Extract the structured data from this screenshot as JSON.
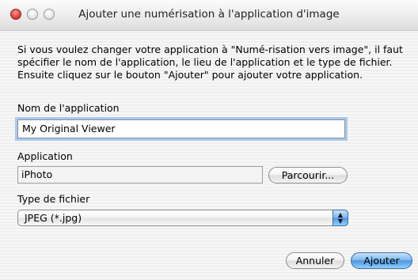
{
  "window": {
    "title": "Ajouter une numérisation à l'application d'image"
  },
  "description": "Si vous voulez changer votre application à \"Numé-risation vers image\", il faut spécifier le nom de l'application, le lieu de l'application et le type de fichier. Ensuite cliquez sur le bouton \"Ajouter\" pour ajouter votre application.",
  "form": {
    "name_label": "Nom de l'application",
    "name_value": "My Original Viewer",
    "app_label": "Application",
    "app_value": "iPhoto",
    "browse_label": "Parcourir...",
    "type_label": "Type de fichier",
    "type_value": "JPEG (*.jpg)"
  },
  "buttons": {
    "cancel": "Annuler",
    "add": "Ajouter"
  },
  "icons": {
    "close": "close-icon",
    "minimize": "minimize-icon",
    "zoom": "zoom-icon",
    "select_arrows": "up-down-arrows-icon"
  }
}
